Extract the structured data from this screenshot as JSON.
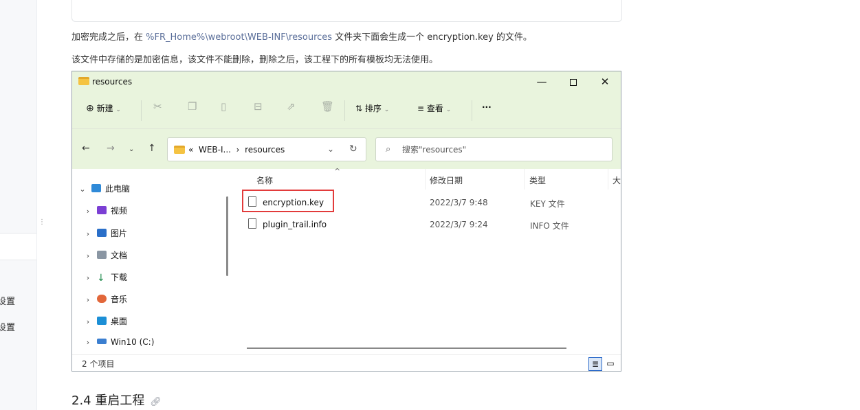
{
  "sidebar": {
    "items": [
      {
        "label": "设置"
      },
      {
        "label": "设置"
      }
    ]
  },
  "doc": {
    "para1_before": "加密完成之后，在 ",
    "para1_code": "%FR_Home%\\webroot\\WEB-INF\\resources",
    "para1_after": " 文件夹下面会生成一个 encryption.key 的文件。",
    "para2": "该文件中存储的是加密信息，该文件不能删除，删除之后，该工程下的所有模板均无法使用。",
    "section_title": "2.4 重启工程",
    "anchor_icon": "link-icon"
  },
  "explorer": {
    "title": "resources",
    "window_controls": {
      "minimize": "—",
      "close": "✕"
    },
    "commands": {
      "new_label": "新建",
      "sort_label": "排序",
      "view_label": "查看",
      "more_label": "···",
      "disabled_icons": [
        "cut-icon",
        "copy-icon",
        "paste-icon",
        "rename-icon",
        "share-icon",
        "delete-icon"
      ]
    },
    "address": {
      "prefix": "«",
      "crumb1": "WEB-I...",
      "crumb_sep": "›",
      "crumb2": "resources"
    },
    "search_placeholder": "搜索\"resources\"",
    "tree": [
      {
        "label": "此电脑",
        "expanded": true,
        "icon": "monitor-icon",
        "color": "#2f8ad8"
      },
      {
        "label": "视频",
        "icon": "video-icon",
        "color": "#7b3fd4"
      },
      {
        "label": "图片",
        "icon": "picture-icon",
        "color": "#2a6fc9"
      },
      {
        "label": "文档",
        "icon": "document-icon",
        "color": "#8a96a3"
      },
      {
        "label": "下载",
        "icon": "download-icon",
        "color": "#1f8a4c"
      },
      {
        "label": "音乐",
        "icon": "music-icon",
        "color": "#e2673a"
      },
      {
        "label": "桌面",
        "icon": "desktop-icon",
        "color": "#1c8fd6"
      },
      {
        "label": "Win10 (C:)",
        "icon": "drive-icon",
        "color": "#3b7fd0"
      }
    ],
    "columns": {
      "name": "名称",
      "modified": "修改日期",
      "type": "类型",
      "size": "大"
    },
    "files": [
      {
        "name": "encryption.key",
        "modified": "2022/3/7 9:48",
        "type": "KEY 文件"
      },
      {
        "name": "plugin_trail.info",
        "modified": "2022/3/7 9:24",
        "type": "INFO 文件"
      }
    ],
    "status_count": "2 个项目"
  }
}
